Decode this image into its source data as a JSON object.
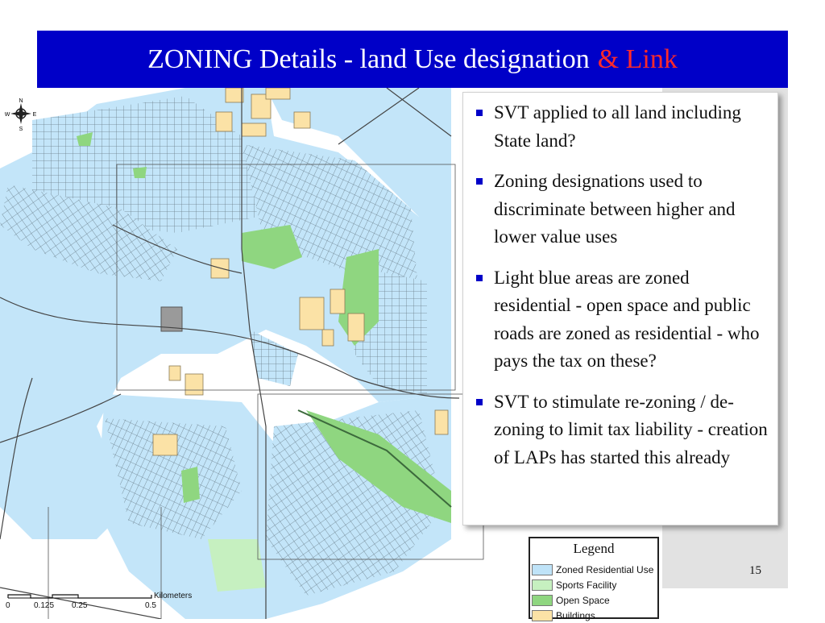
{
  "title": {
    "main": "ZONING Details - land Use designation",
    "accent": "& Link"
  },
  "bullets": [
    "SVT applied to all land including State land?",
    "Zoning designations used to discriminate between higher and lower value uses",
    "Light blue areas are zoned residential - open space and public roads are zoned as residential - who pays the tax on these?",
    "SVT to stimulate re-zoning / de-zoning to limit tax liability -  creation of LAPs has started this already"
  ],
  "legend": {
    "title": "Legend",
    "items": [
      {
        "label": "Zoned Residential Use",
        "color": "#bfe3f8"
      },
      {
        "label": "Sports Facility",
        "color": "#c6f0c0"
      },
      {
        "label": "Open Space",
        "color": "#8fd680"
      },
      {
        "label": "Buildings",
        "color": "#fbe2a6"
      }
    ]
  },
  "scale": {
    "ticks": [
      "0",
      "0.125",
      "0.25",
      "0.5"
    ],
    "unit": "Kilometers"
  },
  "compass": {
    "n": "N",
    "s": "S",
    "e": "E",
    "w": "W"
  },
  "page_number": "15",
  "colors": {
    "title_bg": "#0000c8",
    "accent": "#ff2a2a",
    "residential": "#bfe3f8",
    "open_space": "#8fd680",
    "sports": "#c6f0c0",
    "buildings": "#fbe2a6",
    "slide_gray": "#e2e2e2"
  }
}
